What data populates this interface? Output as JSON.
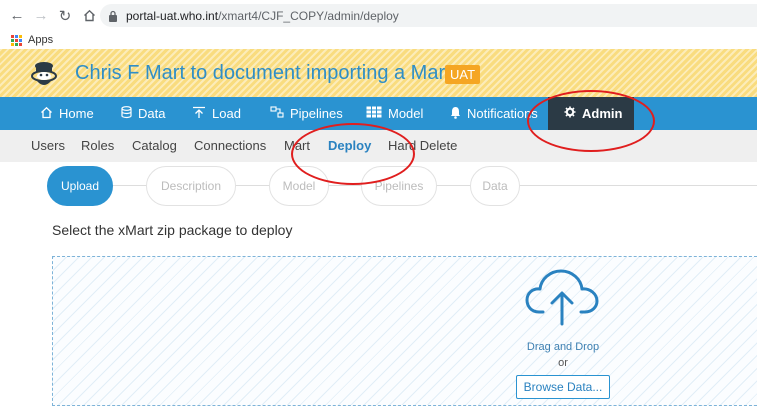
{
  "browser": {
    "url_host": "portal-uat.who.int",
    "url_path": "/xmart4/CJF_COPY/admin/deploy",
    "bookmark_apps": "Apps"
  },
  "header": {
    "title": "Chris F Mart to document importing a Mart",
    "badge": "UAT",
    "logo_icon": "xmart-logo-icon"
  },
  "main_nav": [
    {
      "label": "Home",
      "icon": "home-icon"
    },
    {
      "label": "Data",
      "icon": "database-icon"
    },
    {
      "label": "Load",
      "icon": "upload-icon"
    },
    {
      "label": "Pipelines",
      "icon": "pipelines-icon"
    },
    {
      "label": "Model",
      "icon": "model-icon"
    },
    {
      "label": "Notifications",
      "icon": "bell-icon"
    },
    {
      "label": "Admin",
      "icon": "gear-icon",
      "active": true
    }
  ],
  "sub_nav": [
    {
      "label": "Users"
    },
    {
      "label": "Roles"
    },
    {
      "label": "Catalog"
    },
    {
      "label": "Connections"
    },
    {
      "label": "Mart"
    },
    {
      "label": "Deploy",
      "active": true
    },
    {
      "label": "Hard Delete"
    }
  ],
  "steps": [
    {
      "label": "Upload",
      "active": true
    },
    {
      "label": "Description"
    },
    {
      "label": "Model"
    },
    {
      "label": "Pipelines"
    },
    {
      "label": "Data"
    }
  ],
  "prompt": "Select the xMart zip package to deploy",
  "dropzone": {
    "icon": "cloud-upload-icon",
    "drag_text": "Drag and Drop",
    "or_text": "or",
    "browse_label": "Browse Data..."
  },
  "colors": {
    "nav_blue": "#2a93d1",
    "admin_dark": "#2b3a45",
    "header_yellow": "#f9dc7f",
    "badge_orange": "#f5a623",
    "annotation_red": "#e01e1e"
  }
}
